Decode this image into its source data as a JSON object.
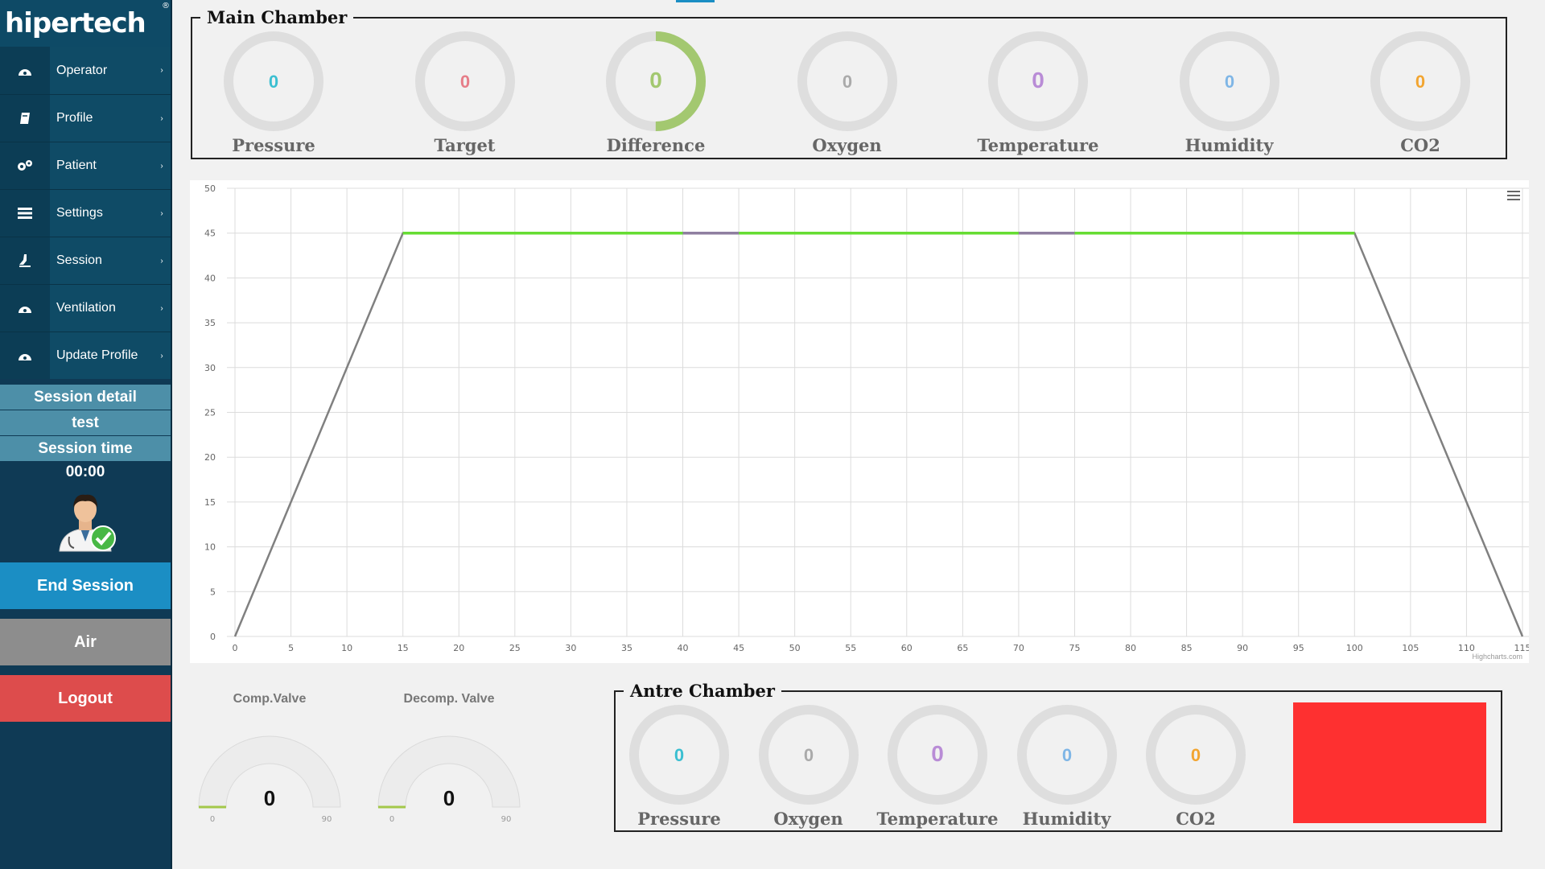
{
  "brand": {
    "logo_text": "hipertech",
    "registered": "®"
  },
  "sidebar": {
    "menu": [
      {
        "label": "Operator",
        "icon": "dashboard-icon"
      },
      {
        "label": "Profile",
        "icon": "book-icon"
      },
      {
        "label": "Patient",
        "icon": "gears-icon"
      },
      {
        "label": "Settings",
        "icon": "list-icon"
      },
      {
        "label": "Session",
        "icon": "flask-icon"
      },
      {
        "label": "Ventilation",
        "icon": "dashboard-icon"
      },
      {
        "label": "Update Profile",
        "icon": "dashboard-icon"
      }
    ],
    "chevron": "›",
    "session_detail_label": "Session detail",
    "session_name": "test",
    "session_time_label": "Session time",
    "session_time": "00:00",
    "buttons": {
      "end_session": "End Session",
      "air": "Air",
      "logout": "Logout"
    }
  },
  "main_chamber": {
    "title": "Main Chamber",
    "gauges": [
      {
        "label": "Pressure",
        "value": "0",
        "color": "#3bbfd1",
        "fill_fraction": 0
      },
      {
        "label": "Target",
        "value": "0",
        "color": "#e67d88",
        "fill_fraction": 0
      },
      {
        "label": "Difference",
        "value": "0",
        "color": "#a3c870",
        "fill_fraction": 0.5
      },
      {
        "label": "Oxygen",
        "value": "0",
        "color": "#aaaaaa",
        "fill_fraction": 0
      },
      {
        "label": "Temperature",
        "value": "0",
        "color": "#b98cd6",
        "fill_fraction": 0
      },
      {
        "label": "Humidity",
        "value": "0",
        "color": "#7fb6e6",
        "fill_fraction": 0
      },
      {
        "label": "CO2",
        "value": "0",
        "color": "#f2a531",
        "fill_fraction": 0
      }
    ]
  },
  "chart_data": {
    "type": "line",
    "xlim": [
      0,
      115
    ],
    "ylim": [
      0,
      50
    ],
    "x_ticks": [
      0,
      5,
      10,
      15,
      20,
      25,
      30,
      35,
      40,
      45,
      50,
      55,
      60,
      65,
      70,
      75,
      80,
      85,
      90,
      95,
      100,
      105,
      110,
      115
    ],
    "y_ticks": [
      0,
      5,
      10,
      15,
      20,
      25,
      30,
      35,
      40,
      45,
      50
    ],
    "grid": true,
    "series": [
      {
        "color": "#808080",
        "points": [
          [
            0,
            0
          ],
          [
            15,
            45
          ],
          [
            100,
            45
          ],
          [
            115,
            0
          ]
        ]
      },
      {
        "color": "#66dd33",
        "points": [
          [
            15,
            45
          ],
          [
            40,
            45
          ]
        ]
      },
      {
        "color": "#66dd33",
        "points": [
          [
            45,
            45
          ],
          [
            70,
            45
          ]
        ]
      },
      {
        "color": "#66dd33",
        "points": [
          [
            75,
            45
          ],
          [
            100,
            45
          ]
        ]
      },
      {
        "color": "#8f7fa0",
        "points": [
          [
            40,
            45
          ],
          [
            45,
            45
          ]
        ]
      },
      {
        "color": "#8f7fa0",
        "points": [
          [
            70,
            45
          ],
          [
            75,
            45
          ]
        ]
      }
    ],
    "credits": "Highcharts.com"
  },
  "valves": [
    {
      "title": "Comp.Valve",
      "value": "0",
      "min": "0",
      "max": "90",
      "fill_fraction": 0
    },
    {
      "title": "Decomp. Valve",
      "value": "0",
      "min": "0",
      "max": "90",
      "fill_fraction": 0
    }
  ],
  "antre_chamber": {
    "title": "Antre Chamber",
    "gauges": [
      {
        "label": "Pressure",
        "value": "0",
        "color": "#3bbfd1"
      },
      {
        "label": "Oxygen",
        "value": "0",
        "color": "#aaaaaa"
      },
      {
        "label": "Temperature",
        "value": "0",
        "color": "#b98cd6"
      },
      {
        "label": "Humidity",
        "value": "0",
        "color": "#7fb6e6"
      },
      {
        "label": "CO2",
        "value": "0",
        "color": "#f2a531"
      }
    ],
    "status_color": "#fe3030"
  }
}
